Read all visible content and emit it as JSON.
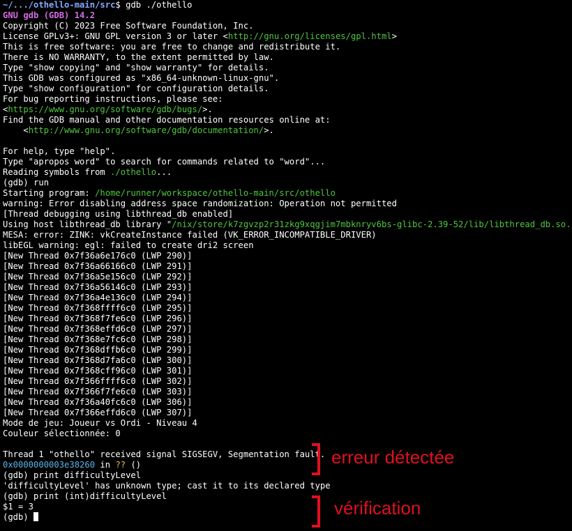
{
  "prompt": {
    "path": "~/.../othello-main/src",
    "symbol": "$",
    "command": " gdb ./othello"
  },
  "gdb_version": "GNU gdb (GDB) 14.2",
  "copyright": "Copyright (C) 2023 Free Software Foundation, Inc.",
  "license": {
    "prefix": "License GPLv3+: GNU GPL version 3 or later <",
    "url": "http://gnu.org/licenses/gpl.html",
    "suffix": ">"
  },
  "free_software": "This is free software: you are free to change and redistribute it.",
  "no_warranty": "There is NO WARRANTY, to the extent permitted by law.",
  "show_copying": "Type \"show copying\" and \"show warranty\" for details.",
  "configured": "This GDB was configured as \"x86_64-unknown-linux-gnu\".",
  "show_config": "Type \"show configuration\" for configuration details.",
  "bug_reporting": "For bug reporting instructions, please see:",
  "bug_url": {
    "prefix": "<",
    "url": "https://www.gnu.org/software/gdb/bugs/",
    "suffix": ">."
  },
  "find_manual": "Find the GDB manual and other documentation resources online at:",
  "doc_url": {
    "prefix": "    <",
    "url": "http://www.gnu.org/software/gdb/documentation/",
    "suffix": ">."
  },
  "help": "For help, type \"help\".",
  "apropos": "Type \"apropos word\" to search for commands related to \"word\"...",
  "reading": {
    "prefix": "Reading symbols from ",
    "file": "./othello",
    "suffix": "..."
  },
  "run_cmd": "(gdb) run",
  "starting": {
    "prefix": "Starting program: ",
    "path": "/home/runner/workspace/othello-main/src/othello"
  },
  "warning_aslr": "warning: Error disabling address space randomization: Operation not permitted",
  "thread_debugging": "[Thread debugging using libthread_db enabled]",
  "libthread": {
    "prefix": "Using host libthread_db library \"",
    "path": "/nix/store/k7zgvzp2r31zkg9xqgjim7mbknryv6bs-glibc-2.39-52/lib/libthread_db.so.1",
    "suffix": "\"."
  },
  "mesa_error": "MESA: error: ZINK: vkCreateInstance failed (VK_ERROR_INCOMPATIBLE_DRIVER)",
  "libegl_warning": "libEGL warning: egl: failed to create dri2 screen",
  "threads": [
    "[New Thread 0x7f36a6e176c0 (LWP 290)]",
    "[New Thread 0x7f36a66166c0 (LWP 291)]",
    "[New Thread 0x7f36a5e156c0 (LWP 292)]",
    "[New Thread 0x7f36a56146c0 (LWP 293)]",
    "[New Thread 0x7f36a4e136c0 (LWP 294)]",
    "[New Thread 0x7f368ffff6c0 (LWP 295)]",
    "[New Thread 0x7f368f7fe6c0 (LWP 296)]",
    "[New Thread 0x7f368effd6c0 (LWP 297)]",
    "[New Thread 0x7f368e7fc6c0 (LWP 298)]",
    "[New Thread 0x7f368dffb6c0 (LWP 299)]",
    "[New Thread 0x7f368d7fa6c0 (LWP 300)]",
    "[New Thread 0x7f368cff96c0 (LWP 301)]",
    "[New Thread 0x7f366ffff6c0 (LWP 302)]",
    "[New Thread 0x7f366f7fe6c0 (LWP 303)]",
    "[New Thread 0x7f36a40fc6c0 (LWP 306)]",
    "[New Thread 0x7f366effd6c0 (LWP 307)]"
  ],
  "mode": "Mode de jeu: Joueur vs Ordi - Niveau 4",
  "couleur": "Couleur sélectionnée: 0",
  "signal": "Thread 1 \"othello\" received signal SIGSEGV, Segmentation fault.",
  "frame": {
    "address": "0x0000000003e38260",
    "in": " in ",
    "func": "??",
    "args": " ()"
  },
  "print_cmd": "(gdb) print difficultyLevel",
  "unknown_type": "'difficultyLevel' has unknown type; cast it to its declared type",
  "print_int_cmd": "(gdb) print (int)difficultyLevel",
  "result": "$1 = 3",
  "final_prompt": "(gdb) ",
  "annotations": {
    "error": "erreur détectée",
    "verification": "vérification",
    "color": "#e0101f"
  },
  "colors": {
    "background": "#000000",
    "text": "#ffffff",
    "prompt_path": "#87a8ff",
    "gdb_banner": "#d36be6",
    "url": "#4ec73e",
    "address": "#5ab4e8",
    "function": "#e0c341"
  }
}
